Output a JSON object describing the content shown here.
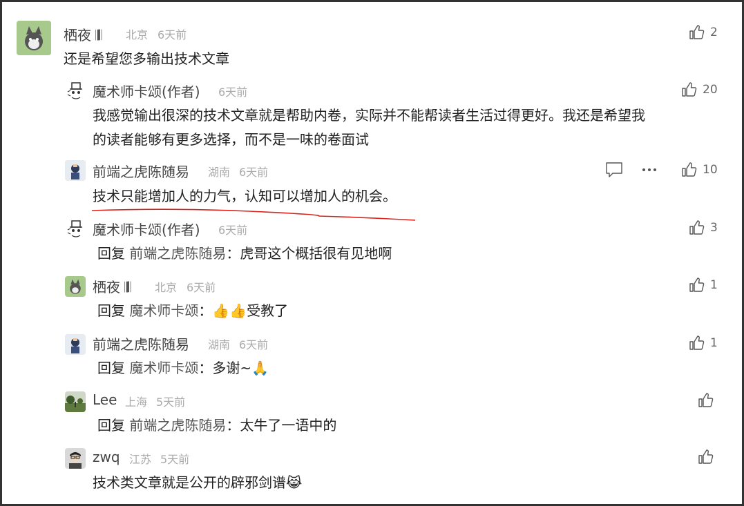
{
  "comments": [
    {
      "name": "栖夜 𝄂𝄃",
      "location": "北京",
      "time": "6天前",
      "text": "还是希望您多输出技术文章",
      "likes": "2",
      "replies": [
        {
          "name": "魔术师卡颂(作者)",
          "location": "",
          "time": "6天前",
          "text_line1": "我感觉输出很深的技术文章就是帮助内卷，实际并不能帮读者生活过得更好。我还是希望我",
          "text_line2": "的读者能够有更多选择，而不是一味的卷面试",
          "likes": "20"
        },
        {
          "name": "前端之虎陈随易",
          "location": "湖南",
          "time": "6天前",
          "text": "技术只能增加人的力气，认知可以增加人的机会。",
          "likes": "10"
        },
        {
          "name": "魔术师卡颂(作者)",
          "location": "",
          "time": "6天前",
          "reply_label": "回复",
          "reply_to": "前端之虎陈随易",
          "text": "：虎哥这个概括很有见地啊",
          "likes": "3"
        },
        {
          "name": "栖夜 𝄂𝄃",
          "location": "北京",
          "time": "6天前",
          "reply_label": "回复",
          "reply_to": "魔术师卡颂",
          "text": "：👍👍受教了",
          "likes": "1"
        },
        {
          "name": "前端之虎陈随易",
          "location": "湖南",
          "time": "6天前",
          "reply_label": "回复",
          "reply_to": "魔术师卡颂",
          "text": "：多谢~🙏",
          "likes": "1"
        },
        {
          "name": "Lee",
          "location": "上海",
          "time": "5天前",
          "reply_label": "回复",
          "reply_to": "前端之虎陈随易",
          "text": "：太牛了一语中的",
          "likes": ""
        }
      ]
    },
    {
      "name": "zwq",
      "location": "江苏",
      "time": "5天前",
      "text": "技术类文章就是公开的辟邪剑谱😹",
      "likes": ""
    }
  ],
  "icons": {
    "like": "thumbs-up-icon",
    "comment": "comment-icon",
    "more": "more-dots-icon"
  },
  "colors": {
    "underline": "#d9241c",
    "avatar_cat_bg": "#a8c98a",
    "avatar_tiger_bg": "#dde6ef"
  }
}
